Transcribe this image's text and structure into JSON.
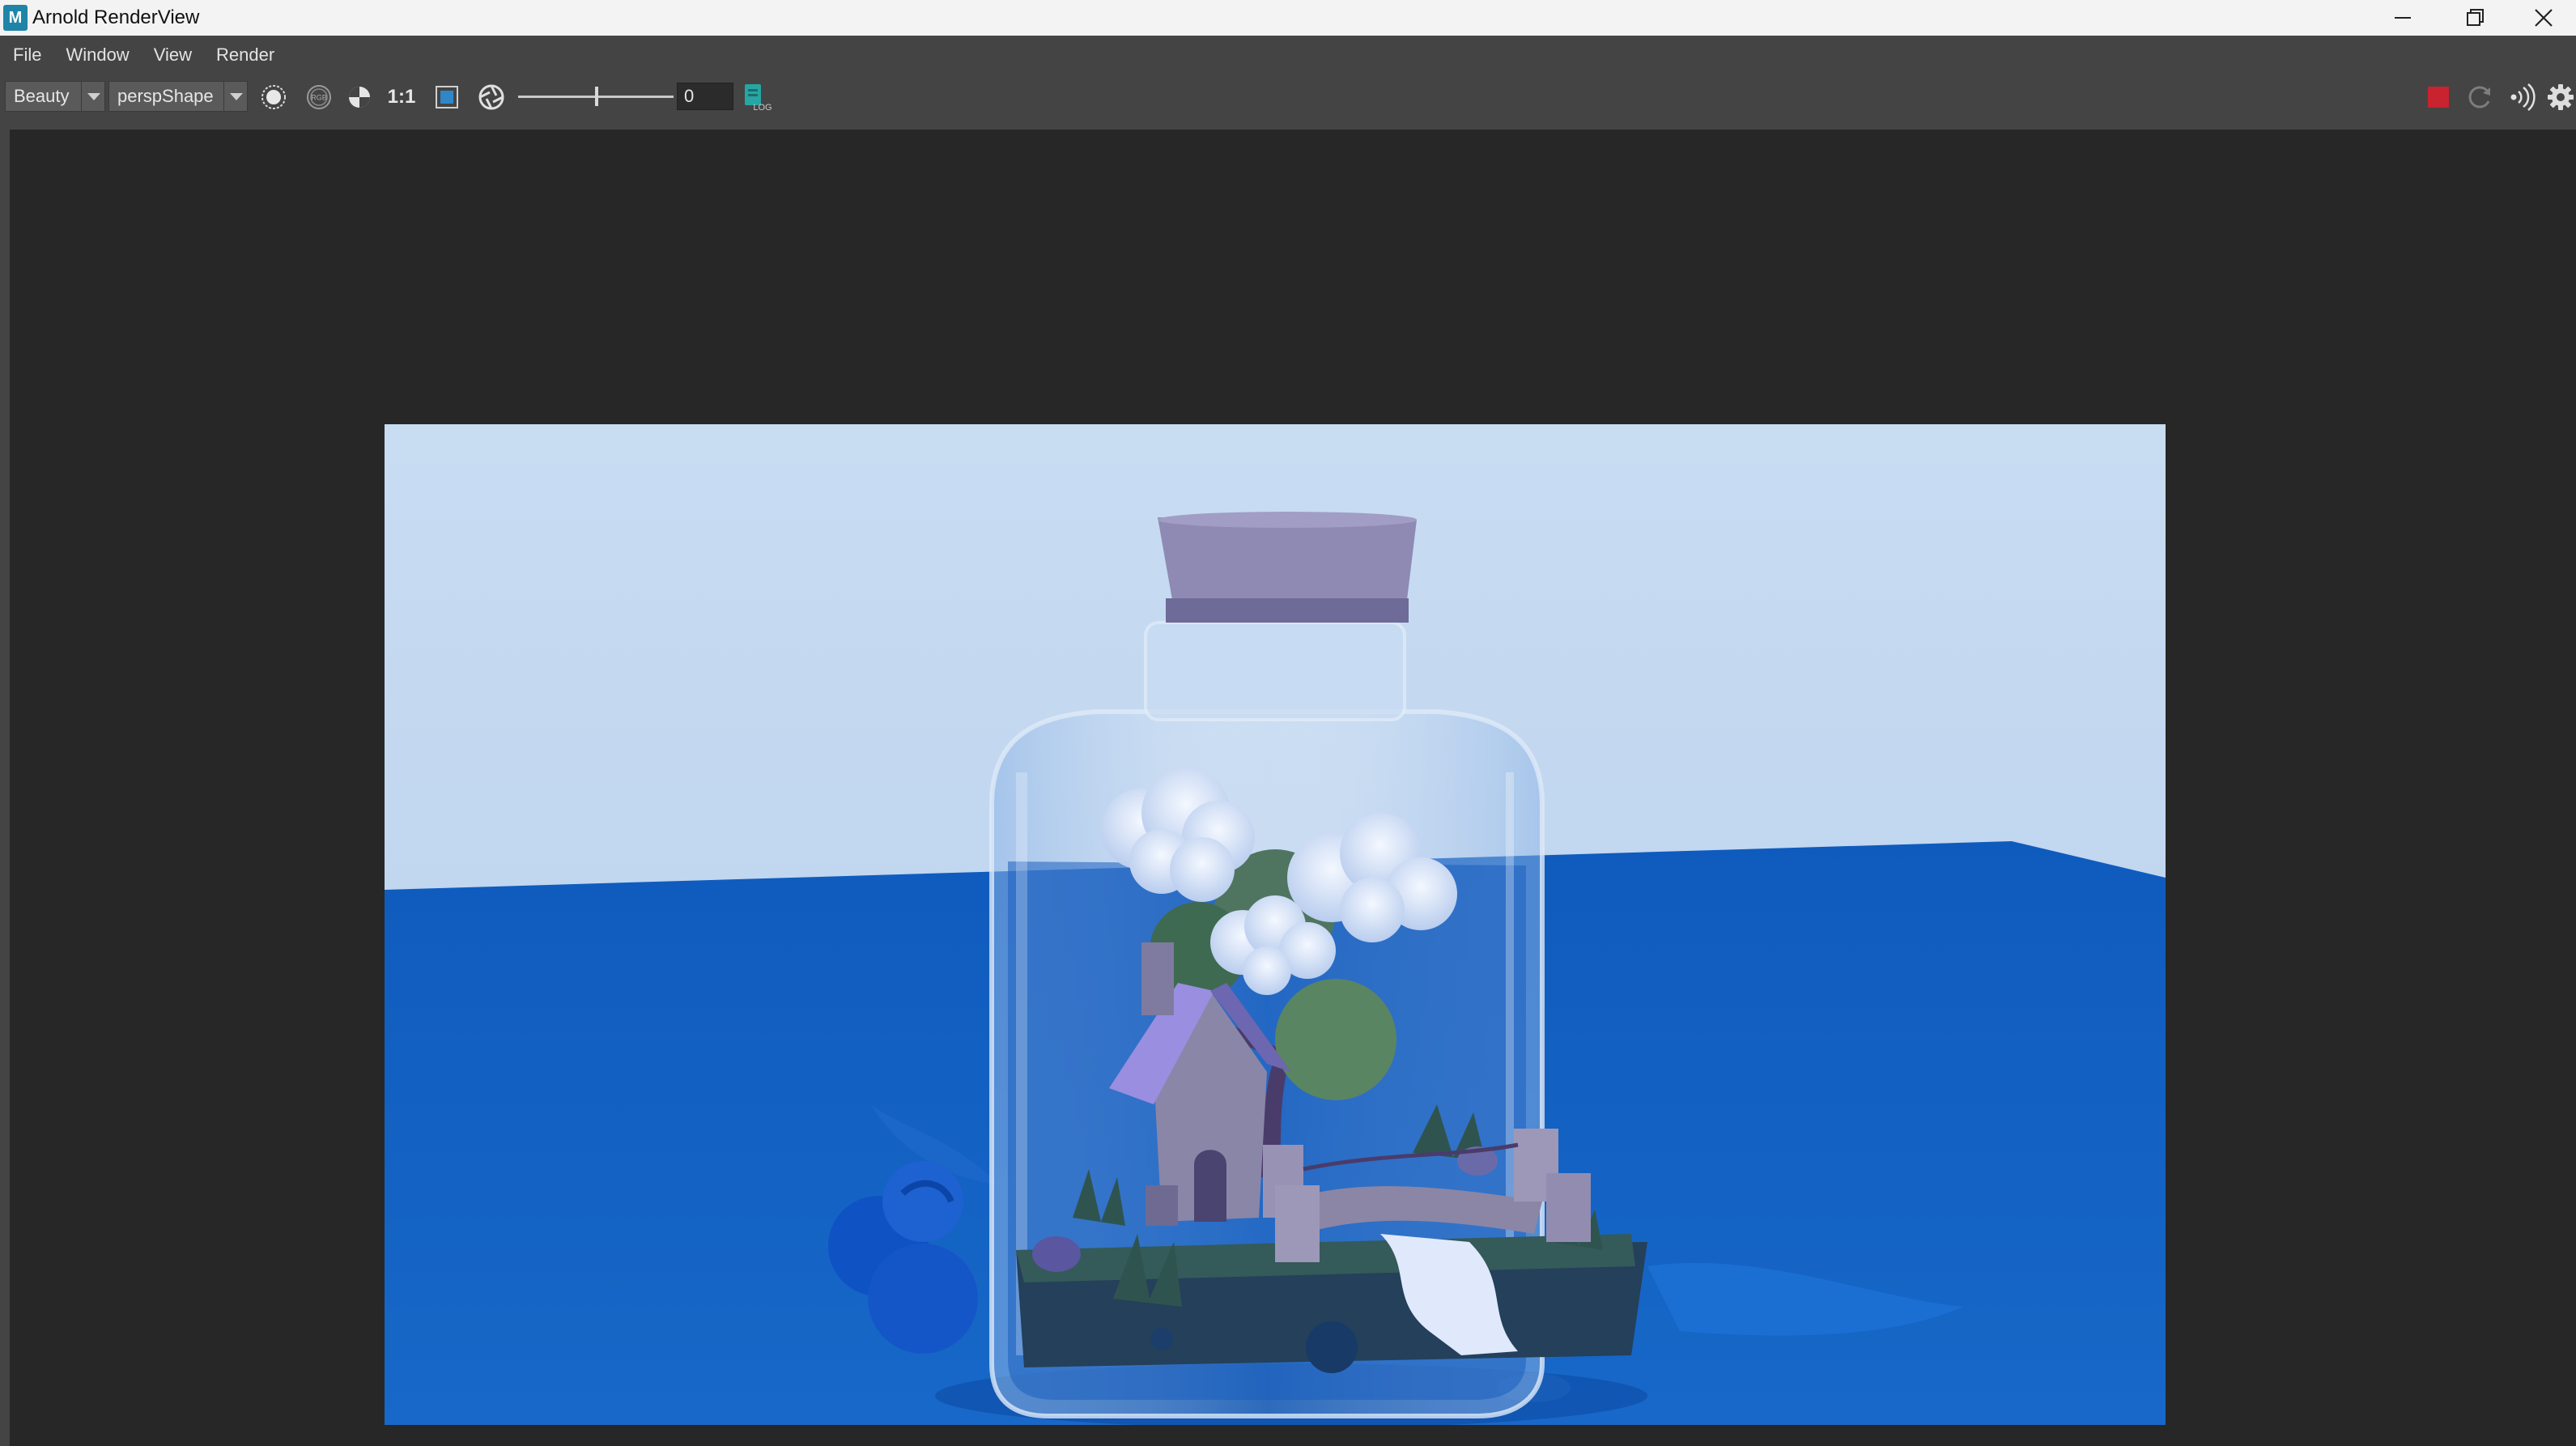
{
  "window": {
    "app_icon": "M",
    "title": "Arnold RenderView",
    "controls": [
      "minimize-icon",
      "restore-icon",
      "close-icon"
    ]
  },
  "menu": {
    "items": [
      "File",
      "Window",
      "View",
      "Render"
    ]
  },
  "toolbar": {
    "aov": "Beauty",
    "camera": "perspShape",
    "one_to_one": "1:1",
    "exposure_value": "0",
    "log_label": "LOG",
    "icons": [
      "display-channel-icon",
      "rgb-icon",
      "alpha-icon",
      "one-to-one-icon",
      "frame-icon",
      "lens-icon",
      "log-icon",
      "stop-render-icon",
      "refresh-icon",
      "ipr-icon",
      "settings-icon"
    ]
  },
  "colors": {
    "stop_button": "#c8232f",
    "background": "#272727",
    "toolbar": "#444444",
    "render_sky": "#c6d8ef",
    "render_ground": "#1565c8"
  }
}
